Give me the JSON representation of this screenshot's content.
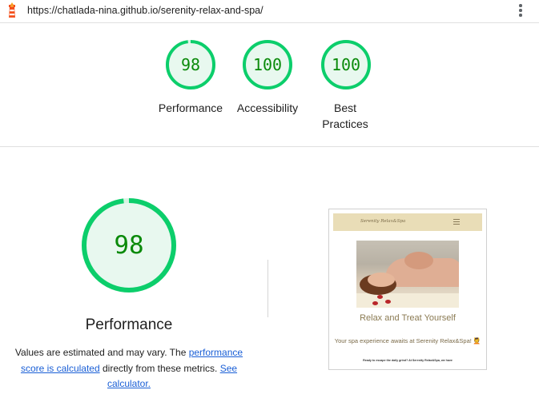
{
  "browser": {
    "url": "https://chatlada-nina.github.io/serenity-relax-and-spa/",
    "logo_icon": "lighthouse-icon",
    "menu_icon": "kebab-menu-icon"
  },
  "summary": {
    "gauges": [
      {
        "label": "Performance",
        "score": "98",
        "score_value": 98
      },
      {
        "label": "Accessibility",
        "score": "100",
        "score_value": 100
      },
      {
        "label": "Best Practices",
        "score": "100",
        "score_value": 100
      }
    ]
  },
  "performance": {
    "score": "98",
    "score_value": 98,
    "title": "Performance",
    "desc_prefix": "Values are estimated and may vary. The ",
    "desc_link1": "performance score is calculated",
    "desc_middle": " directly from these metrics. ",
    "desc_link2": "See calculator."
  },
  "thumbnail": {
    "logo_text": "Serenity Relax&Spa",
    "headline": "Relax and Treat Yourself",
    "subline": "Your spa experience awaits at Serenity Relax&Spa! 💆",
    "body": "Ready to escape the daily grind? At Serenity Relax&Spa, we have"
  },
  "colors": {
    "pass_green": "#0cce6b",
    "pass_fill": "#e8f8ef",
    "score_text": "#0a8a0a",
    "link": "#1a5fd6"
  }
}
